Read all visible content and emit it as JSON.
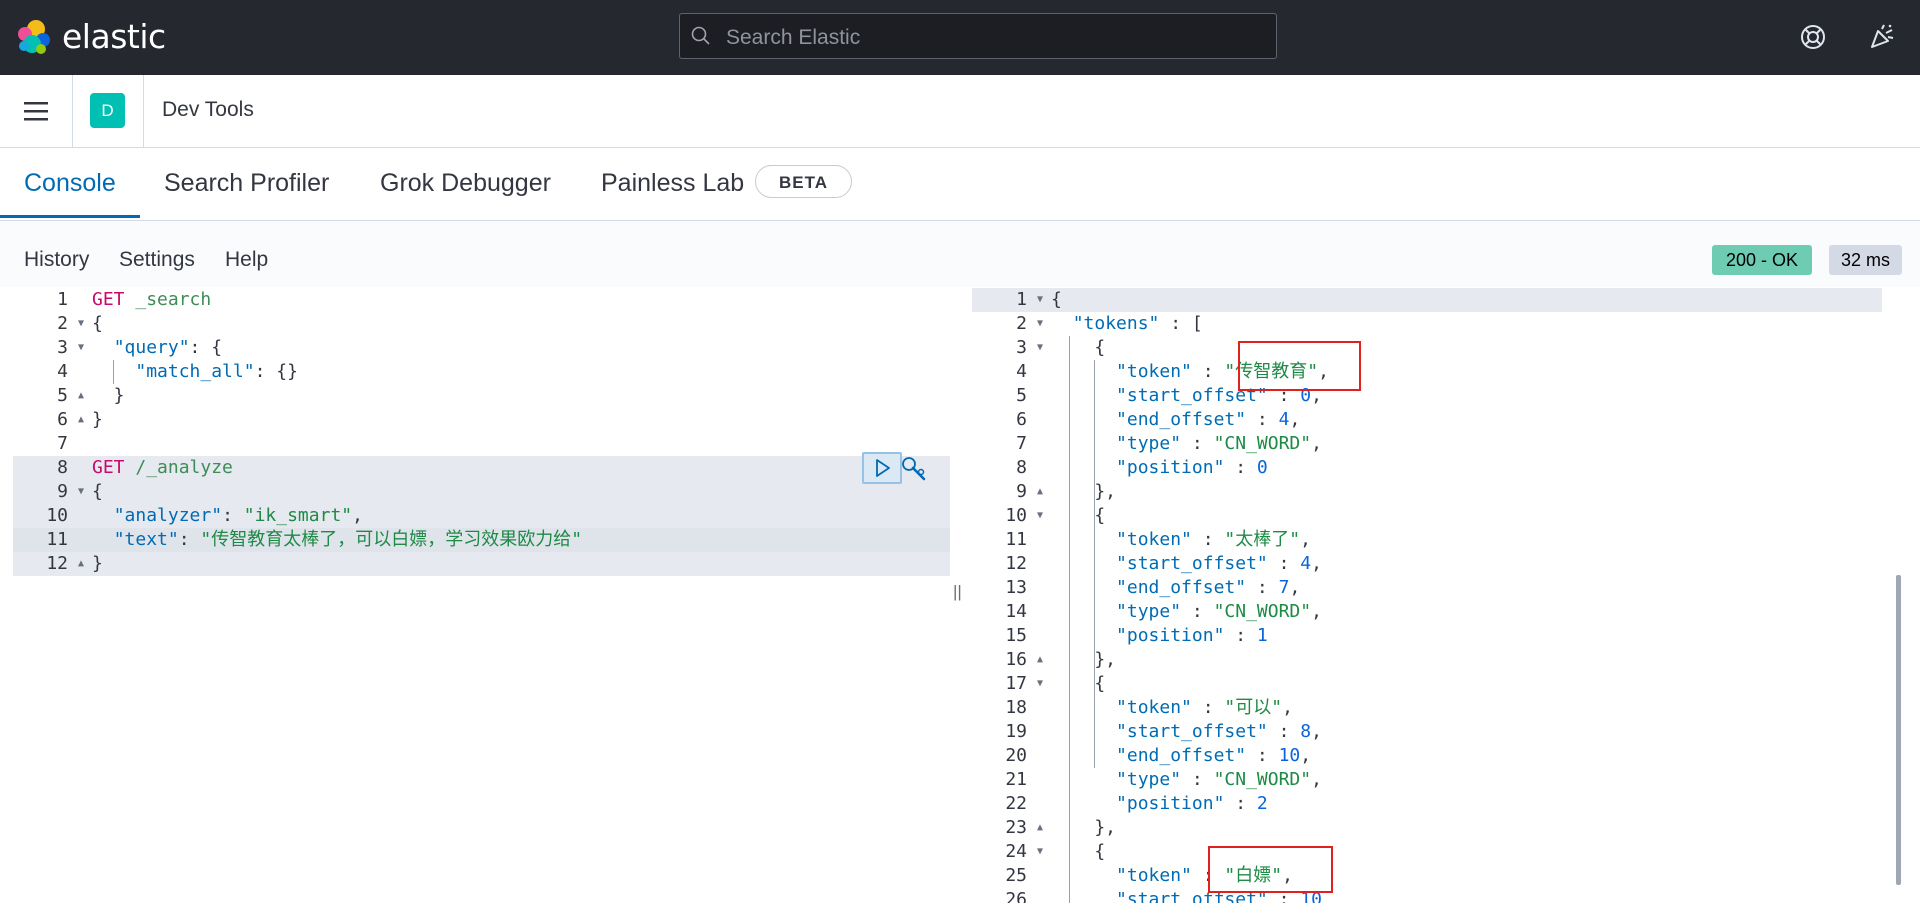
{
  "app": {
    "brand": "elastic",
    "search_placeholder": "Search Elastic",
    "space_initial": "D",
    "breadcrumb": "Dev Tools"
  },
  "tabs": [
    {
      "label": "Console",
      "active": true
    },
    {
      "label": "Search Profiler",
      "active": false
    },
    {
      "label": "Grok Debugger",
      "active": false
    },
    {
      "label": "Painless Lab",
      "active": false,
      "badge": "BETA"
    }
  ],
  "toolbar": {
    "history": "History",
    "settings": "Settings",
    "help": "Help",
    "status": "200 - OK",
    "time": "32 ms"
  },
  "request_lines": [
    {
      "n": "1",
      "fold": "",
      "parts": [
        [
          "m",
          "GET"
        ],
        [
          "p",
          " "
        ],
        [
          "u",
          "_search"
        ]
      ]
    },
    {
      "n": "2",
      "fold": "▼",
      "parts": [
        [
          "p",
          "{"
        ]
      ]
    },
    {
      "n": "3",
      "fold": "▼",
      "parts": [
        [
          "p",
          "  "
        ],
        [
          "k",
          "\"query\""
        ],
        [
          "p",
          ": {"
        ]
      ]
    },
    {
      "n": "4",
      "fold": "",
      "parts": [
        [
          "p",
          "    "
        ],
        [
          "k",
          "\"match_all\""
        ],
        [
          "p",
          ": {}"
        ]
      ]
    },
    {
      "n": "5",
      "fold": "▲",
      "parts": [
        [
          "p",
          "  }"
        ]
      ]
    },
    {
      "n": "6",
      "fold": "▲",
      "parts": [
        [
          "p",
          "}"
        ]
      ]
    },
    {
      "n": "7",
      "fold": "",
      "parts": []
    },
    {
      "n": "8",
      "fold": "",
      "parts": [
        [
          "m",
          "GET"
        ],
        [
          "p",
          " "
        ],
        [
          "u",
          "/_analyze"
        ]
      ]
    },
    {
      "n": "9",
      "fold": "▼",
      "parts": [
        [
          "p",
          "{"
        ]
      ]
    },
    {
      "n": "10",
      "fold": "",
      "parts": [
        [
          "p",
          "  "
        ],
        [
          "k",
          "\"analyzer\""
        ],
        [
          "p",
          ": "
        ],
        [
          "s",
          "\"ik_smart\""
        ],
        [
          "p",
          ","
        ]
      ]
    },
    {
      "n": "11",
      "fold": "",
      "parts": [
        [
          "p",
          "  "
        ],
        [
          "k",
          "\"text\""
        ],
        [
          "p",
          ": "
        ],
        [
          "s",
          "\"传智教育太棒了，可以白嫖，学习效果欧力给\""
        ]
      ]
    },
    {
      "n": "12",
      "fold": "▲",
      "parts": [
        [
          "p",
          "}"
        ]
      ]
    }
  ],
  "response_lines": [
    {
      "n": "1",
      "fold": "▼",
      "parts": [
        [
          "p",
          "{"
        ]
      ]
    },
    {
      "n": "2",
      "fold": "▼",
      "parts": [
        [
          "p",
          "  "
        ],
        [
          "k",
          "\"tokens\""
        ],
        [
          "p",
          " : ["
        ]
      ]
    },
    {
      "n": "3",
      "fold": "▼",
      "parts": [
        [
          "p",
          "    {"
        ]
      ]
    },
    {
      "n": "4",
      "fold": "",
      "parts": [
        [
          "p",
          "      "
        ],
        [
          "k",
          "\"token\""
        ],
        [
          "p",
          " : "
        ],
        [
          "s",
          "\"传智教育\""
        ],
        [
          "p",
          ","
        ]
      ]
    },
    {
      "n": "5",
      "fold": "",
      "parts": [
        [
          "p",
          "      "
        ],
        [
          "k",
          "\"start_offset\""
        ],
        [
          "p",
          " : "
        ],
        [
          "num",
          "0"
        ],
        [
          "p",
          ","
        ]
      ]
    },
    {
      "n": "6",
      "fold": "",
      "parts": [
        [
          "p",
          "      "
        ],
        [
          "k",
          "\"end_offset\""
        ],
        [
          "p",
          " : "
        ],
        [
          "num",
          "4"
        ],
        [
          "p",
          ","
        ]
      ]
    },
    {
      "n": "7",
      "fold": "",
      "parts": [
        [
          "p",
          "      "
        ],
        [
          "k",
          "\"type\""
        ],
        [
          "p",
          " : "
        ],
        [
          "s",
          "\"CN_WORD\""
        ],
        [
          "p",
          ","
        ]
      ]
    },
    {
      "n": "8",
      "fold": "",
      "parts": [
        [
          "p",
          "      "
        ],
        [
          "k",
          "\"position\""
        ],
        [
          "p",
          " : "
        ],
        [
          "num",
          "0"
        ]
      ]
    },
    {
      "n": "9",
      "fold": "▲",
      "parts": [
        [
          "p",
          "    },"
        ]
      ]
    },
    {
      "n": "10",
      "fold": "▼",
      "parts": [
        [
          "p",
          "    {"
        ]
      ]
    },
    {
      "n": "11",
      "fold": "",
      "parts": [
        [
          "p",
          "      "
        ],
        [
          "k",
          "\"token\""
        ],
        [
          "p",
          " : "
        ],
        [
          "s",
          "\"太棒了\""
        ],
        [
          "p",
          ","
        ]
      ]
    },
    {
      "n": "12",
      "fold": "",
      "parts": [
        [
          "p",
          "      "
        ],
        [
          "k",
          "\"start_offset\""
        ],
        [
          "p",
          " : "
        ],
        [
          "num",
          "4"
        ],
        [
          "p",
          ","
        ]
      ]
    },
    {
      "n": "13",
      "fold": "",
      "parts": [
        [
          "p",
          "      "
        ],
        [
          "k",
          "\"end_offset\""
        ],
        [
          "p",
          " : "
        ],
        [
          "num",
          "7"
        ],
        [
          "p",
          ","
        ]
      ]
    },
    {
      "n": "14",
      "fold": "",
      "parts": [
        [
          "p",
          "      "
        ],
        [
          "k",
          "\"type\""
        ],
        [
          "p",
          " : "
        ],
        [
          "s",
          "\"CN_WORD\""
        ],
        [
          "p",
          ","
        ]
      ]
    },
    {
      "n": "15",
      "fold": "",
      "parts": [
        [
          "p",
          "      "
        ],
        [
          "k",
          "\"position\""
        ],
        [
          "p",
          " : "
        ],
        [
          "num",
          "1"
        ]
      ]
    },
    {
      "n": "16",
      "fold": "▲",
      "parts": [
        [
          "p",
          "    },"
        ]
      ]
    },
    {
      "n": "17",
      "fold": "▼",
      "parts": [
        [
          "p",
          "    {"
        ]
      ]
    },
    {
      "n": "18",
      "fold": "",
      "parts": [
        [
          "p",
          "      "
        ],
        [
          "k",
          "\"token\""
        ],
        [
          "p",
          " : "
        ],
        [
          "s",
          "\"可以\""
        ],
        [
          "p",
          ","
        ]
      ]
    },
    {
      "n": "19",
      "fold": "",
      "parts": [
        [
          "p",
          "      "
        ],
        [
          "k",
          "\"start_offset\""
        ],
        [
          "p",
          " : "
        ],
        [
          "num",
          "8"
        ],
        [
          "p",
          ","
        ]
      ]
    },
    {
      "n": "20",
      "fold": "",
      "parts": [
        [
          "p",
          "      "
        ],
        [
          "k",
          "\"end_offset\""
        ],
        [
          "p",
          " : "
        ],
        [
          "num",
          "10"
        ],
        [
          "p",
          ","
        ]
      ]
    },
    {
      "n": "21",
      "fold": "",
      "parts": [
        [
          "p",
          "      "
        ],
        [
          "k",
          "\"type\""
        ],
        [
          "p",
          " : "
        ],
        [
          "s",
          "\"CN_WORD\""
        ],
        [
          "p",
          ","
        ]
      ]
    },
    {
      "n": "22",
      "fold": "",
      "parts": [
        [
          "p",
          "      "
        ],
        [
          "k",
          "\"position\""
        ],
        [
          "p",
          " : "
        ],
        [
          "num",
          "2"
        ]
      ]
    },
    {
      "n": "23",
      "fold": "▲",
      "parts": [
        [
          "p",
          "    },"
        ]
      ]
    },
    {
      "n": "24",
      "fold": "▼",
      "parts": [
        [
          "p",
          "    {"
        ]
      ]
    },
    {
      "n": "25",
      "fold": "",
      "parts": [
        [
          "p",
          "      "
        ],
        [
          "k",
          "\"token\""
        ],
        [
          "p",
          " : "
        ],
        [
          "s",
          "\"白嫖\""
        ],
        [
          "p",
          ","
        ]
      ]
    },
    {
      "n": "26",
      "fold": "",
      "parts": [
        [
          "p",
          "      "
        ],
        [
          "k",
          "\"start_offset\""
        ],
        [
          "p",
          " : "
        ],
        [
          "num",
          "10"
        ]
      ]
    }
  ],
  "colors": {
    "accent": "#006bb4",
    "method": "#c80a68",
    "string": "#1e8a46",
    "status_ok": "#6dccb1",
    "annotation_box": "#e0211d"
  },
  "icons": [
    "elastic-logo-icon",
    "search-icon",
    "help-icon",
    "newsfeed-icon",
    "menu-icon",
    "play-icon",
    "wrench-icon"
  ]
}
